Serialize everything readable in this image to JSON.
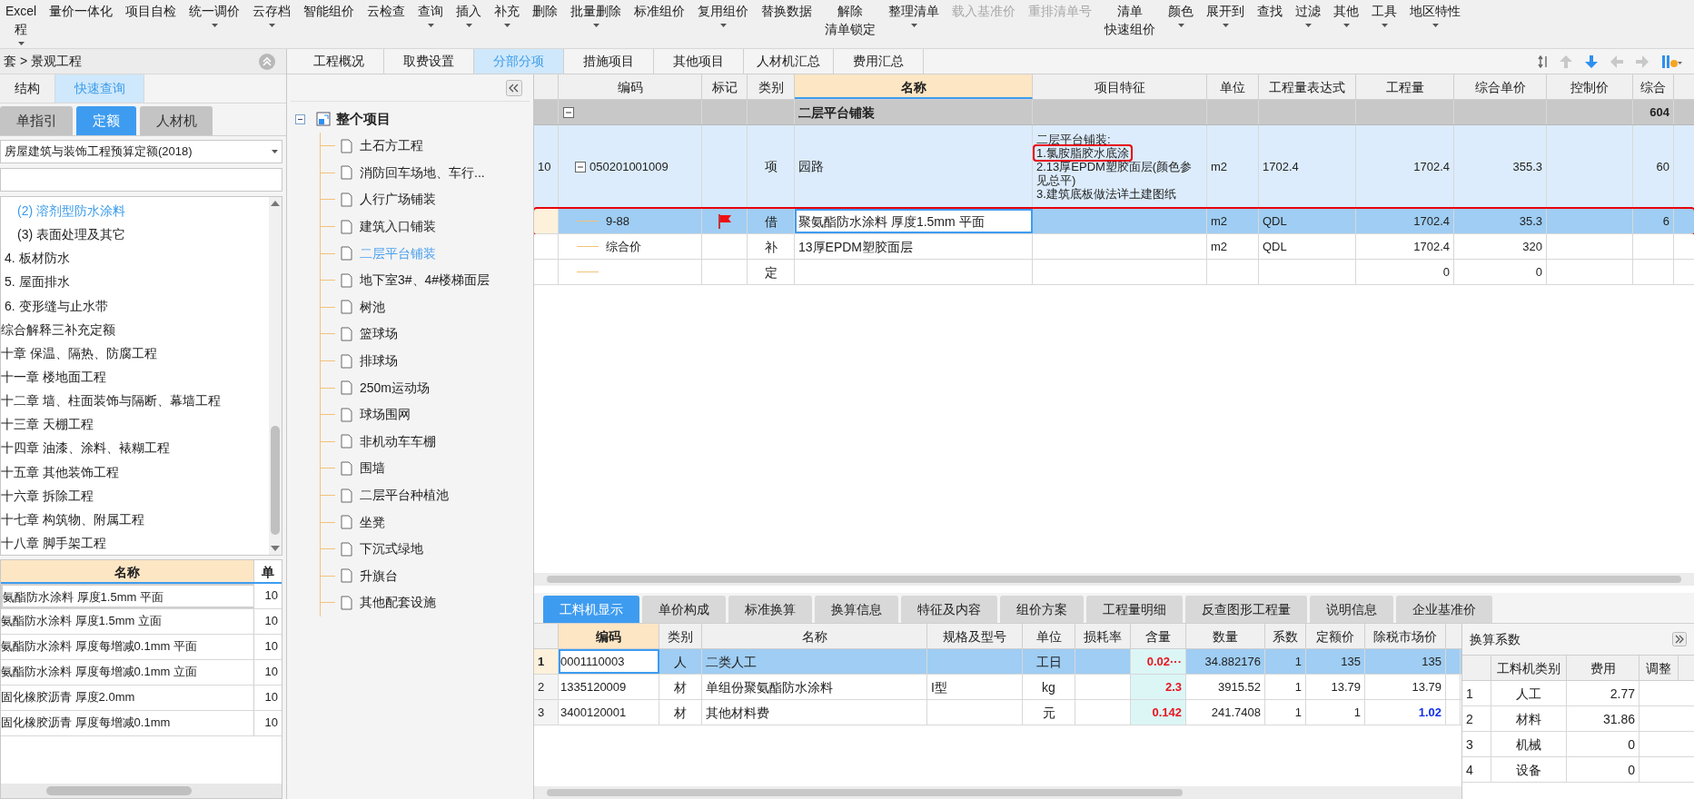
{
  "toolbar": [
    {
      "label": "Excel",
      "line2": "程",
      "dropdown": true,
      "disabled": false
    },
    {
      "label": "量价一体化",
      "dropdown": false,
      "disabled": false
    },
    {
      "label": "项目自检",
      "dropdown": false,
      "disabled": false
    },
    {
      "label": "统一调价",
      "dropdown": true,
      "disabled": false
    },
    {
      "label": "云存档",
      "dropdown": true,
      "disabled": false
    },
    {
      "label": "智能组价",
      "dropdown": false,
      "disabled": false
    },
    {
      "label": "云检查",
      "dropdown": false,
      "disabled": false
    },
    {
      "label": "查询",
      "dropdown": true,
      "disabled": false
    },
    {
      "label": "插入",
      "dropdown": true,
      "disabled": false
    },
    {
      "label": "补充",
      "dropdown": true,
      "disabled": false
    },
    {
      "label": "删除",
      "dropdown": false,
      "disabled": false
    },
    {
      "label": "批量删除",
      "dropdown": true,
      "disabled": false
    },
    {
      "label": "标准组价",
      "dropdown": false,
      "disabled": false
    },
    {
      "label": "复用组价",
      "dropdown": true,
      "disabled": false
    },
    {
      "label": "替换数据",
      "dropdown": false,
      "disabled": false
    },
    {
      "label": "解除",
      "line2": "清单锁定",
      "dropdown": false,
      "disabled": false
    },
    {
      "label": "整理清单",
      "dropdown": true,
      "disabled": false
    },
    {
      "label": "载入基准价",
      "dropdown": false,
      "disabled": true
    },
    {
      "label": "重排清单号",
      "dropdown": false,
      "disabled": true
    },
    {
      "label": "清单",
      "line2": "快速组价",
      "dropdown": false,
      "disabled": false
    },
    {
      "label": "颜色",
      "dropdown": true,
      "disabled": false
    },
    {
      "label": "展开到",
      "dropdown": true,
      "disabled": false
    },
    {
      "label": "查找",
      "dropdown": false,
      "disabled": false
    },
    {
      "label": "过滤",
      "dropdown": true,
      "disabled": false
    },
    {
      "label": "其他",
      "dropdown": true,
      "disabled": false
    },
    {
      "label": "工具",
      "dropdown": true,
      "disabled": false
    },
    {
      "label": "地区特性",
      "dropdown": true,
      "disabled": false
    }
  ],
  "left_panel": {
    "breadcrumb": "套 > 景观工程",
    "tabs": [
      {
        "label": "结构",
        "selected": false
      },
      {
        "label": "快速查询",
        "selected": true
      }
    ],
    "subtabs": [
      {
        "label": "单指引",
        "selected": false
      },
      {
        "label": "定额",
        "selected": true
      },
      {
        "label": "人材机",
        "selected": false
      }
    ],
    "library": "房屋建筑与装饰工程预算定额(2018)",
    "tree": [
      {
        "children": [
          {
            "children": [
              {
                "label": "(2) 溶剂型防水涂料",
                "selected": true
              },
              {
                "label": "(3) 表面处理及其它",
                "selected": false
              }
            ]
          },
          {
            "label": "4.  板材防水",
            "selected": false
          },
          {
            "label": "5.  屋面排水",
            "selected": false
          },
          {
            "label": "6.  变形缝与止水带",
            "selected": false
          }
        ]
      },
      {
        "label": "综合解释三补充定额",
        "selected": false
      },
      {
        "label": "十章  保温、隔热、防腐工程",
        "selected": false
      },
      {
        "label": "十一章  楼地面工程",
        "selected": false
      },
      {
        "label": "十二章  墙、柱面装饰与隔断、幕墙工程",
        "selected": false
      },
      {
        "label": "十三章  天棚工程",
        "selected": false
      },
      {
        "label": "十四章  油漆、涂料、裱糊工程",
        "selected": false
      },
      {
        "label": "十五章  其他装饰工程",
        "selected": false
      },
      {
        "label": "十六章  拆除工程",
        "selected": false
      },
      {
        "label": "十七章  构筑物、附属工程",
        "selected": false
      },
      {
        "label": "十八章  脚手架工程",
        "selected": false
      }
    ],
    "table": {
      "columns": [
        "名称",
        "单"
      ],
      "rows": [
        {
          "name": "氨酯防水涂料 厚度1.5mm 平面",
          "unit": "10",
          "selected": true
        },
        {
          "name": "氨酯防水涂料 厚度1.5mm 立面",
          "unit": "10",
          "selected": false
        },
        {
          "name": "氨酯防水涂料 厚度每增减0.1mm 平面",
          "unit": "10",
          "selected": false
        },
        {
          "name": "氨酯防水涂料 厚度每增减0.1mm 立面",
          "unit": "10",
          "selected": false
        },
        {
          "name": "固化橡胶沥青 厚度2.0mm",
          "unit": "10",
          "selected": false
        },
        {
          "name": "固化橡胶沥青 厚度每增减0.1mm",
          "unit": "10",
          "selected": false
        }
      ]
    }
  },
  "main_tabs": [
    {
      "label": "工程概况",
      "selected": false
    },
    {
      "label": "取费设置",
      "selected": false
    },
    {
      "label": "分部分项",
      "selected": true
    },
    {
      "label": "措施项目",
      "selected": false
    },
    {
      "label": "其他项目",
      "selected": false
    },
    {
      "label": "人材机汇总",
      "selected": false
    },
    {
      "label": "费用汇总",
      "selected": false
    }
  ],
  "project_tree": {
    "label": "整个项目",
    "expanded": true,
    "children": [
      {
        "label": "土石方工程",
        "selected": false
      },
      {
        "label": "消防回车场地、车行...",
        "selected": false
      },
      {
        "label": "人行广场铺装",
        "selected": false
      },
      {
        "label": "建筑入口铺装",
        "selected": false
      },
      {
        "label": "二层平台铺装",
        "selected": true
      },
      {
        "label": "地下室3#、4#楼梯面层",
        "selected": false
      },
      {
        "label": "树池",
        "selected": false
      },
      {
        "label": "篮球场",
        "selected": false
      },
      {
        "label": "排球场",
        "selected": false
      },
      {
        "label": "250m运动场",
        "selected": false
      },
      {
        "label": "球场围网",
        "selected": false
      },
      {
        "label": "非机动车车棚",
        "selected": false
      },
      {
        "label": "围墙",
        "selected": false
      },
      {
        "label": "二层平台种植池",
        "selected": false
      },
      {
        "label": "坐凳",
        "selected": false
      },
      {
        "label": "下沉式绿地",
        "selected": false
      },
      {
        "label": "升旗台",
        "selected": false
      },
      {
        "label": "其他配套设施",
        "selected": false
      }
    ]
  },
  "bill_table": {
    "columns": [
      "编码",
      "标记",
      "类别",
      "名称",
      "项目特征",
      "单位",
      "工程量表达式",
      "工程量",
      "综合单价",
      "控制价",
      "综合"
    ],
    "rows": [
      {
        "kind": "section",
        "expanded": true,
        "name": "二层平台铺装",
        "total": "604"
      },
      {
        "kind": "item",
        "no": "10",
        "expanded": true,
        "code": "050201001009",
        "type": "项",
        "name": "园路",
        "features": [
          {
            "text": "二层平台铺装:",
            "annotated": false
          },
          {
            "text": "1.氯胺脂胶水底涂",
            "annotated": true
          },
          {
            "text": "2.13厚EPDM塑胶面层(颜色参见总平)",
            "annotated": false
          },
          {
            "text": "3.建筑底板做法详土建图纸",
            "annotated": false
          }
        ],
        "unit": "m2",
        "expr": "1702.4",
        "qty": "1702.4",
        "price": "355.3",
        "total": "60",
        "selected": false,
        "annotated": false
      },
      {
        "kind": "sub",
        "code": "9-88",
        "flagged": true,
        "type": "借",
        "name": "聚氨酯防水涂料 厚度1.5mm 平面",
        "editing": true,
        "unit": "m2",
        "expr": "QDL",
        "qty": "1702.4",
        "price": "35.3",
        "total": "6",
        "selected": true,
        "annotated": true
      },
      {
        "kind": "sub",
        "code": "综合价",
        "flagged": false,
        "type": "补",
        "name": "13厚EPDM塑胶面层",
        "editing": false,
        "unit": "m2",
        "expr": "QDL",
        "qty": "1702.4",
        "price": "320",
        "selected": false,
        "annotated": false
      },
      {
        "kind": "sub",
        "flagged": false,
        "type": "定",
        "editing": false,
        "qty": "0",
        "price": "0",
        "selected": false,
        "annotated": false
      }
    ]
  },
  "detail_tabs": [
    {
      "label": "工料机显示",
      "selected": true
    },
    {
      "label": "单价构成",
      "selected": false
    },
    {
      "label": "标准换算",
      "selected": false
    },
    {
      "label": "换算信息",
      "selected": false
    },
    {
      "label": "特征及内容",
      "selected": false
    },
    {
      "label": "组价方案",
      "selected": false
    },
    {
      "label": "工程量明细",
      "selected": false
    },
    {
      "label": "反查图形工程量",
      "selected": false
    },
    {
      "label": "说明信息",
      "selected": false
    },
    {
      "label": "企业基准价",
      "selected": false
    }
  ],
  "resource_table": {
    "columns": [
      "编码",
      "类别",
      "名称",
      "规格及型号",
      "单位",
      "损耗率",
      "含量",
      "数量",
      "系数",
      "定额价",
      "除税市场价"
    ],
    "rows": [
      {
        "no": "1",
        "code": "0001110003",
        "type": "人",
        "name": "二类人工",
        "spec": "",
        "unit": "工日",
        "content": "0.02···",
        "content_modified": true,
        "quantity": "34.882176",
        "factor": "1",
        "base_price": "135",
        "market_price": "135",
        "price_modified": false,
        "selected": true
      },
      {
        "no": "2",
        "code": "1335120009",
        "type": "材",
        "name": "单组份聚氨酯防水涂料",
        "spec": "I型",
        "unit": "kg",
        "content": "2.3",
        "content_modified": true,
        "quantity": "3915.52",
        "factor": "1",
        "base_price": "13.79",
        "market_price": "13.79",
        "price_modified": false,
        "selected": false
      },
      {
        "no": "3",
        "code": "3400120001",
        "type": "材",
        "name": "其他材料费",
        "spec": "",
        "unit": "元",
        "content": "0.142",
        "content_modified": true,
        "quantity": "241.7408",
        "factor": "1",
        "base_price": "1",
        "market_price": "1.02",
        "price_modified": true,
        "selected": false
      }
    ]
  },
  "conversion_panel": {
    "title": "换算系数",
    "columns": [
      "工料机类别",
      "费用",
      "调整"
    ],
    "rows": [
      {
        "no": "1",
        "category": "人工",
        "cost": "2.77"
      },
      {
        "no": "2",
        "category": "材料",
        "cost": "31.86"
      },
      {
        "no": "3",
        "category": "机械",
        "cost": "0"
      },
      {
        "no": "4",
        "category": "设备",
        "cost": "0"
      }
    ]
  }
}
